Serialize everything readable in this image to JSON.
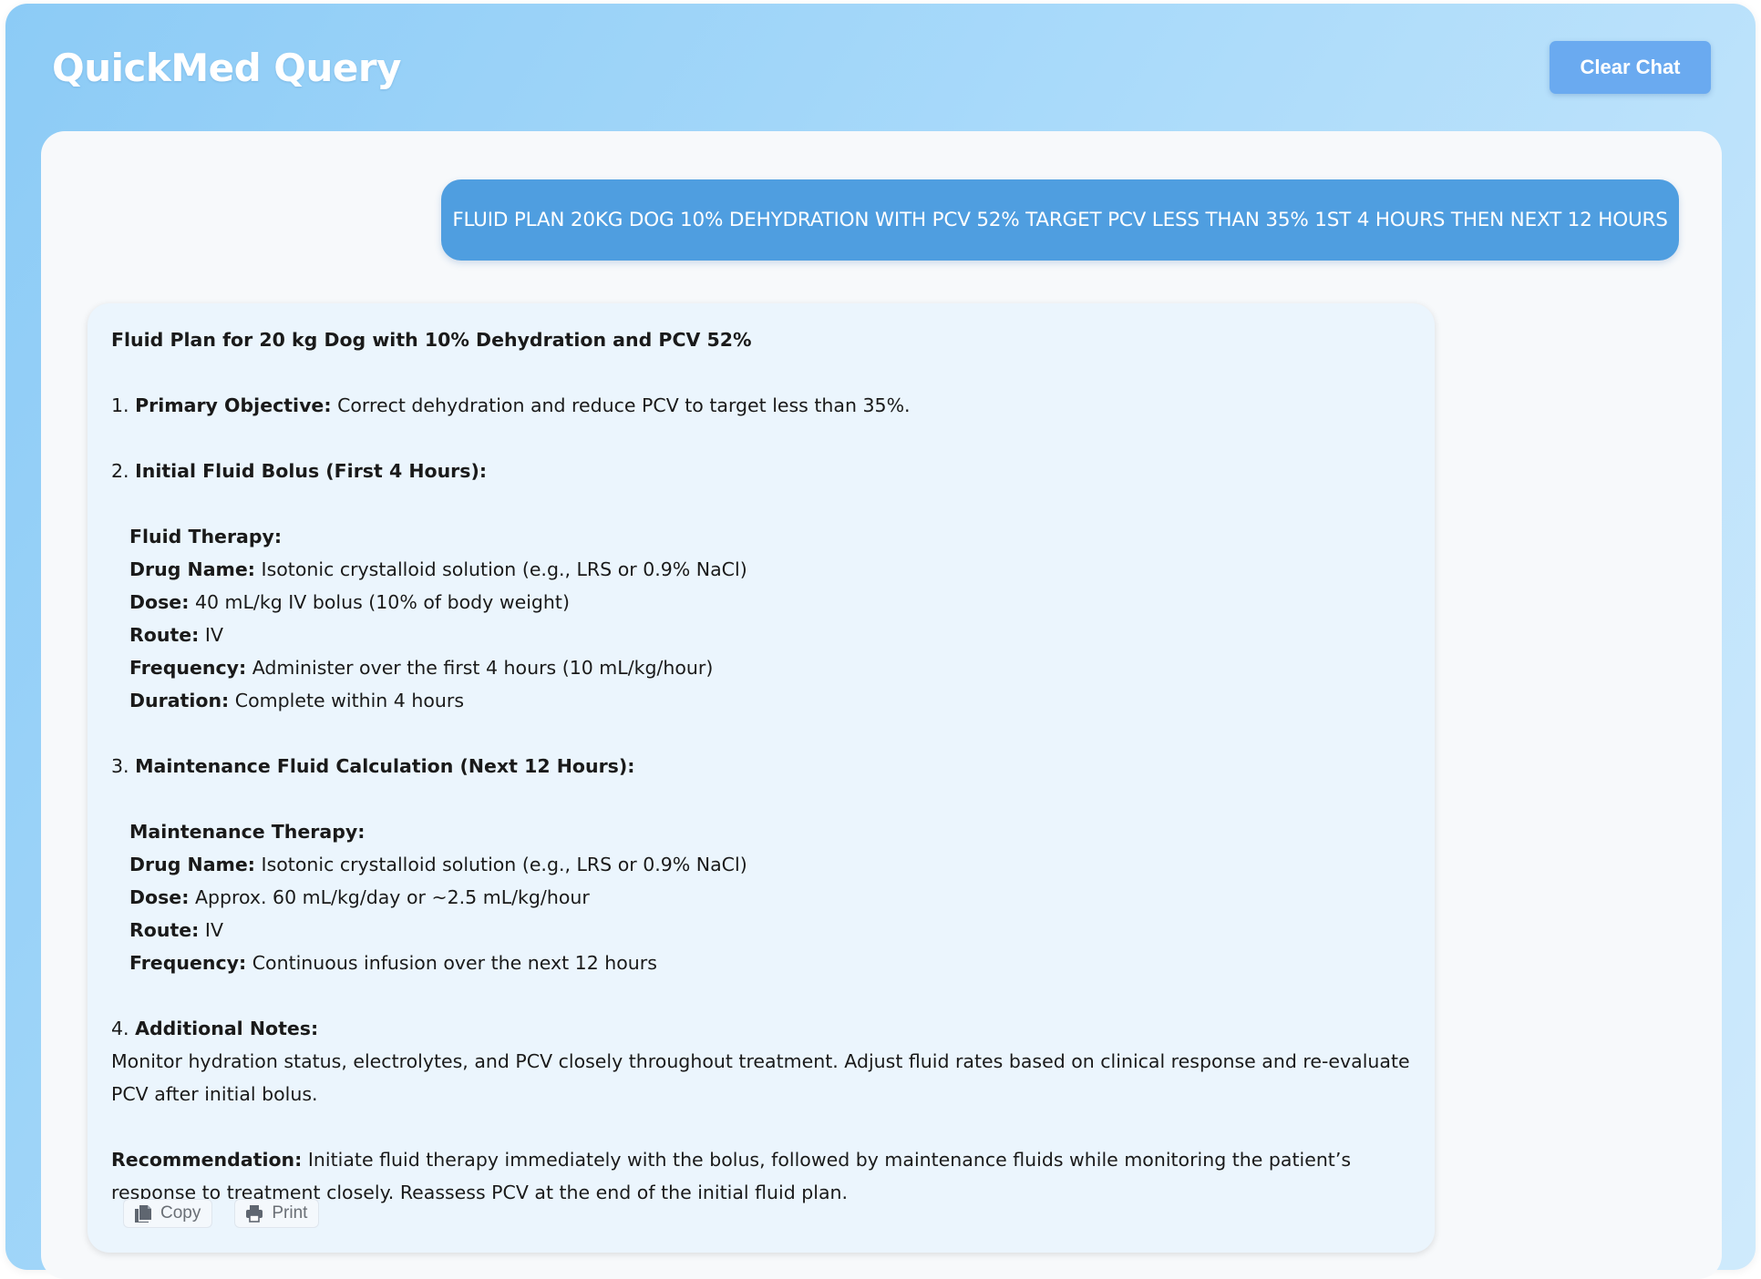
{
  "header": {
    "app_title": "QuickMed Query",
    "clear_label": "Clear Chat"
  },
  "user_message": "FLUID PLAN 20KG DOG 10% DEHYDRATION WITH PCV 52% TARGET PCV LESS THAN 35% 1ST 4 HOURS THEN NEXT 12 HOURS",
  "response": {
    "heading": "Fluid Plan for 20 kg Dog with 10% Dehydration and PCV 52%",
    "s1_num": "1.",
    "s1_label": "Primary Objective:",
    "s1_text": "Correct dehydration and reduce PCV to target less than 35%.",
    "s2_num": "2.",
    "s2_label": "Initial Fluid Bolus (First 4 Hours):",
    "s2_sub": "Fluid Therapy:",
    "s2_items": [
      {
        "label": "Drug Name:",
        "value": "Isotonic crystalloid solution (e.g., LRS or 0.9% NaCl)"
      },
      {
        "label": "Dose:",
        "value": "40 mL/kg IV bolus (10% of body weight)"
      },
      {
        "label": "Route:",
        "value": "IV"
      },
      {
        "label": "Frequency:",
        "value": "Administer over the first 4 hours (10 mL/kg/hour)"
      },
      {
        "label": "Duration:",
        "value": "Complete within 4 hours"
      }
    ],
    "s3_num": "3.",
    "s3_label": "Maintenance Fluid Calculation (Next 12 Hours):",
    "s3_sub": "Maintenance Therapy:",
    "s3_items": [
      {
        "label": "Drug Name:",
        "value": "Isotonic crystalloid solution (e.g., LRS or 0.9% NaCl)"
      },
      {
        "label": "Dose:",
        "value": "Approx. 60 mL/kg/day or ~2.5 mL/kg/hour"
      },
      {
        "label": "Route:",
        "value": "IV"
      },
      {
        "label": "Frequency:",
        "value": "Continuous infusion over the next 12 hours"
      }
    ],
    "s4_num": "4.",
    "s4_label": "Additional Notes:",
    "s4_text": "Monitor hydration status, electrolytes, and PCV closely throughout treatment. Adjust fluid rates based on clinical response and re-evaluate PCV after initial bolus.",
    "rec_label": "Recommendation:",
    "rec_text": "Initiate fluid therapy immediately with the bolus, followed by maintenance fluids while monitoring the patient’s response to treatment closely. Reassess PCV at the end of the initial fluid plan."
  },
  "actions": {
    "copy_label": "Copy",
    "print_label": "Print",
    "copy_icon": "copy-icon",
    "print_icon": "printer-icon"
  },
  "colors": {
    "accent": "#4f9ee0",
    "button": "#6aaaf0",
    "response_bg": "#ebf5fd"
  }
}
